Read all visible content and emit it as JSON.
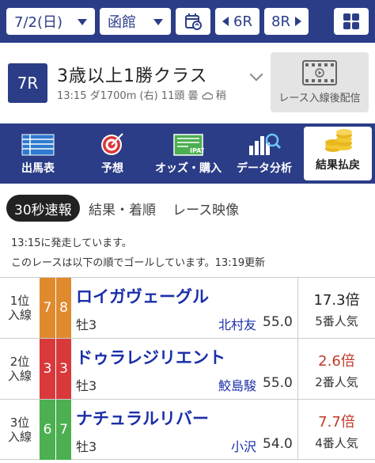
{
  "topbar": {
    "date": "7/2(日)",
    "venue": "函館",
    "prev_race": "6R",
    "next_race": "8R"
  },
  "race": {
    "number": "7R",
    "title": "3歳以上1勝クラス",
    "time": "13:15",
    "surface": "ダ1700m",
    "course": "(右)",
    "runners": "11頭",
    "weather": "曇",
    "track": "稍",
    "video_label": "レース入線後配信"
  },
  "menu": {
    "tabs": [
      {
        "label": "出馬表"
      },
      {
        "label": "予想"
      },
      {
        "label": "オッズ・購入",
        "icon_text": "IPAT"
      },
      {
        "label": "データ分析"
      },
      {
        "label": "結果払戻"
      }
    ]
  },
  "subtabs": [
    "30秒速報",
    "結果・着順",
    "レース映像"
  ],
  "messages": {
    "start": "13:15に発走しています。",
    "goal": "このレースは以下の順でゴールしています。13:19更新"
  },
  "results": [
    {
      "rank": "1位",
      "status": "入線",
      "waku": "7",
      "umaban": "8",
      "horse": "ロイガヴェーグル",
      "sexage": "牡3",
      "jockey": "北村友",
      "weight": "55.0",
      "odds": "17.3倍",
      "popularity": "5番人気"
    },
    {
      "rank": "2位",
      "status": "入線",
      "waku": "3",
      "umaban": "3",
      "horse": "ドゥラレジリエント",
      "sexage": "牡3",
      "jockey": "鮫島駿",
      "weight": "55.0",
      "odds": "2.6倍",
      "popularity": "2番人気"
    },
    {
      "rank": "3位",
      "status": "入線",
      "waku": "6",
      "umaban": "7",
      "horse": "ナチュラルリバー",
      "sexage": "牡3",
      "jockey": "小沢",
      "weight": "54.0",
      "odds": "7.7倍",
      "popularity": "4番人気"
    }
  ],
  "colors": {
    "primary": "#2b3d87",
    "horse_name": "#1a2fa8",
    "waku_7": "#e08a2e",
    "waku_3": "#d9393a",
    "waku_6": "#4caf50",
    "odds_favored": "#c0392b"
  }
}
